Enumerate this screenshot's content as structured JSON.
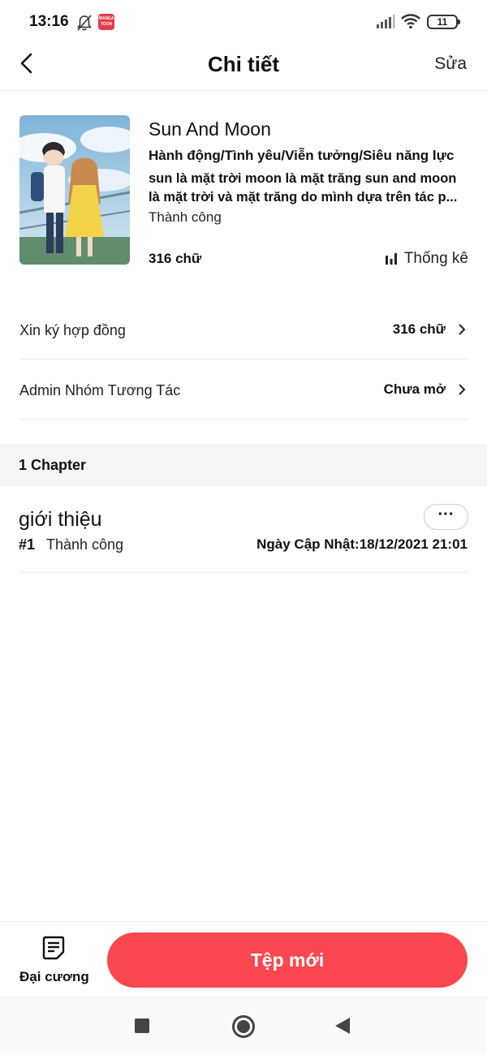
{
  "status_bar": {
    "time": "13:16",
    "battery": "11",
    "app_badge_text": "MANGA TOON"
  },
  "header": {
    "title": "Chi tiết",
    "edit_label": "Sửa"
  },
  "book": {
    "title": "Sun And Moon",
    "genres": "Hành động/Tình yêu/Viễn tưởng/Siêu năng lực",
    "description": "sun là mặt trời moon là mặt trăng sun and moon là mặt trời và mặt trăng do mình dựa trên tác p...",
    "status": "Thành công",
    "word_count": "316 chữ",
    "stats_label": "Thống kê"
  },
  "rows": [
    {
      "label": "Xin ký hợp đồng",
      "value": "316 chữ"
    },
    {
      "label": "Admin Nhóm Tương Tác",
      "value": "Chưa mở"
    }
  ],
  "chapters_section": {
    "count_label": "1 Chapter"
  },
  "chapters": [
    {
      "title": "giới thiệu",
      "number": "#1",
      "status": "Thành công",
      "updated": "Ngày Cập Nhật:18/12/2021 21:01",
      "more_label": "···"
    }
  ],
  "bottom_bar": {
    "outline_label": "Đại cương",
    "new_file_label": "Tệp mới"
  },
  "colors": {
    "accent": "#fb474f",
    "section_band": "#f5f5f5",
    "divider": "#eeeeee"
  }
}
